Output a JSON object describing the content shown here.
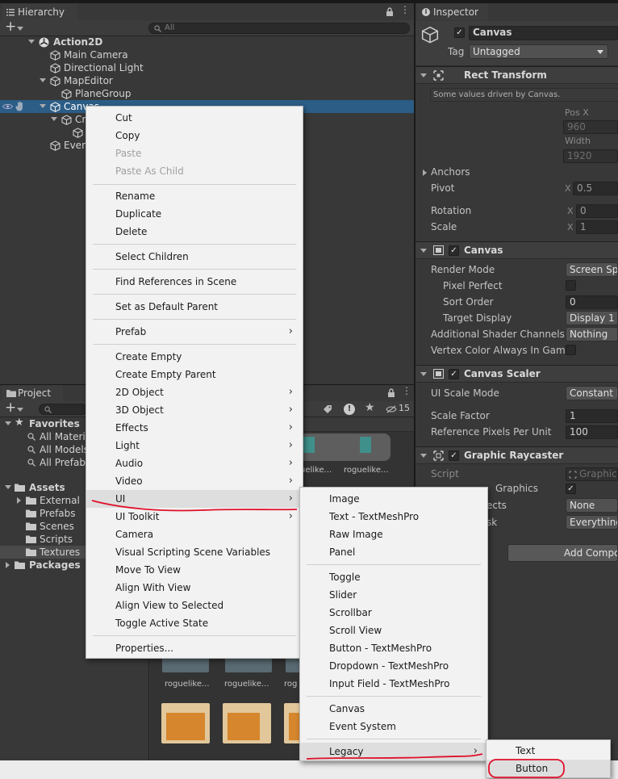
{
  "hierarchy": {
    "tab_label": "Hierarchy",
    "search_placeholder": "All",
    "items": [
      {
        "label": "Action2D"
      },
      {
        "label": "Main Camera"
      },
      {
        "label": "Directional Light"
      },
      {
        "label": "MapEditor"
      },
      {
        "label": "PlaneGroup"
      },
      {
        "label": "Canvas"
      },
      {
        "label": "Cr"
      },
      {
        "label": "Even"
      }
    ]
  },
  "project": {
    "tab_label": "Project",
    "hidden_count": "15",
    "favorites_label": "Favorites",
    "favorites": [
      "All Materia",
      "All Models",
      "All Prefabs"
    ],
    "assets_label": "Assets",
    "assets": [
      "External",
      "Prefabs",
      "Scenes",
      "Scripts",
      "Textures"
    ],
    "packages_label": "Packages",
    "thumb_labels": [
      "uelike...",
      "roguelike...",
      "roguelike...",
      "roguelike...",
      "rog"
    ]
  },
  "inspector": {
    "tab_label": "Inspector",
    "object_name": "Canvas",
    "tag_label": "Tag",
    "tag_value": "Untagged",
    "rect_transform": {
      "title": "Rect Transform",
      "note": "Some values driven by Canvas.",
      "posx_label": "Pos X",
      "posx_value": "960",
      "width_label": "Width",
      "width_value": "1920",
      "anchors_label": "Anchors",
      "pivot_label": "Pivot",
      "pivot_axis": "X",
      "pivot_x": "0.5",
      "rotation_label": "Rotation",
      "rotation_axis": "X",
      "rotation_x": "0",
      "scale_label": "Scale",
      "scale_axis": "X",
      "scale_x": "1"
    },
    "canvas": {
      "title": "Canvas",
      "render_mode_label": "Render Mode",
      "render_mode_value": "Screen Spa",
      "pixel_perfect_label": "Pixel Perfect",
      "sort_order_label": "Sort Order",
      "sort_order_value": "0",
      "target_display_label": "Target Display",
      "target_display_value": "Display 1",
      "shader_channels_label": "Additional Shader Channels",
      "shader_channels_value": "Nothing",
      "vertex_color_label": "Vertex Color Always In Gamm"
    },
    "canvas_scaler": {
      "title": "Canvas Scaler",
      "ui_scale_mode_label": "UI Scale Mode",
      "ui_scale_mode_value": "Constant P",
      "scale_factor_label": "Scale Factor",
      "scale_factor_value": "1",
      "ref_pixels_label": "Reference Pixels Per Unit",
      "ref_pixels_value": "100"
    },
    "graphic_raycaster": {
      "title": "Graphic Raycaster",
      "script_label": "Script",
      "script_value": "GraphicR",
      "ignore_label": "Graphics",
      "blocking_objects_label": "ects",
      "blocking_objects_value": "None",
      "blocking_mask_label": "sk",
      "blocking_mask_value": "Everything"
    },
    "add_component_label": "Add Compon"
  },
  "context_menu": {
    "items": [
      {
        "label": "Cut"
      },
      {
        "label": "Copy"
      },
      {
        "label": "Paste"
      },
      {
        "label": "Paste As Child"
      },
      {
        "label": "Rename"
      },
      {
        "label": "Duplicate"
      },
      {
        "label": "Delete"
      },
      {
        "label": "Select Children"
      },
      {
        "label": "Find References in Scene"
      },
      {
        "label": "Set as Default Parent"
      },
      {
        "label": "Prefab"
      },
      {
        "label": "Create Empty"
      },
      {
        "label": "Create Empty Parent"
      },
      {
        "label": "2D Object"
      },
      {
        "label": "3D Object"
      },
      {
        "label": "Effects"
      },
      {
        "label": "Light"
      },
      {
        "label": "Audio"
      },
      {
        "label": "Video"
      },
      {
        "label": "UI"
      },
      {
        "label": "UI Toolkit"
      },
      {
        "label": "Camera"
      },
      {
        "label": "Visual Scripting Scene Variables"
      },
      {
        "label": "Move To View"
      },
      {
        "label": "Align With View"
      },
      {
        "label": "Align View to Selected"
      },
      {
        "label": "Toggle Active State"
      },
      {
        "label": "Properties..."
      }
    ]
  },
  "ui_submenu": {
    "items": [
      {
        "label": "Image"
      },
      {
        "label": "Text - TextMeshPro"
      },
      {
        "label": "Raw Image"
      },
      {
        "label": "Panel"
      },
      {
        "label": "Toggle"
      },
      {
        "label": "Slider"
      },
      {
        "label": "Scrollbar"
      },
      {
        "label": "Scroll View"
      },
      {
        "label": "Button - TextMeshPro"
      },
      {
        "label": "Dropdown - TextMeshPro"
      },
      {
        "label": "Input Field - TextMeshPro"
      },
      {
        "label": "Canvas"
      },
      {
        "label": "Event System"
      },
      {
        "label": "Legacy"
      }
    ]
  },
  "legacy_submenu": {
    "items": [
      {
        "label": "Text"
      },
      {
        "label": "Button"
      }
    ]
  },
  "colors": {
    "selection": "#2c5d87",
    "annotation_red": "#e0102a",
    "menu_bg": "#f2f2f2"
  }
}
